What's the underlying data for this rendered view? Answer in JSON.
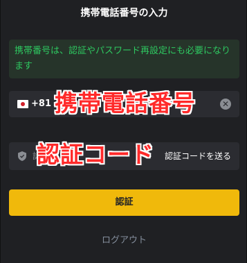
{
  "dialog": {
    "title": "携帯電話番号の入力",
    "notice": "携帯番号は、認証やパスワード再設定にも必要になります"
  },
  "phone": {
    "country_code": "+81",
    "flag_icon": "japan-flag-icon",
    "clear_icon": "clear-circle-icon",
    "clear_glyph": "✕"
  },
  "code": {
    "placeholder": "認証",
    "send_label": "認証コードを送る",
    "shield_icon": "shield-icon"
  },
  "overlays": {
    "phone_annotation": "携帯電話番号",
    "code_annotation": "認証コード"
  },
  "actions": {
    "submit_label": "認証",
    "logout_label": "ログアウト"
  },
  "colors": {
    "background": "#1f2023",
    "input_bg": "#2b2c31",
    "notice_text": "#2ec760",
    "notice_bg": "#26342a",
    "primary": "#f0b90b",
    "annotation_red": "#ff2a2a",
    "muted": "#848e9c"
  }
}
